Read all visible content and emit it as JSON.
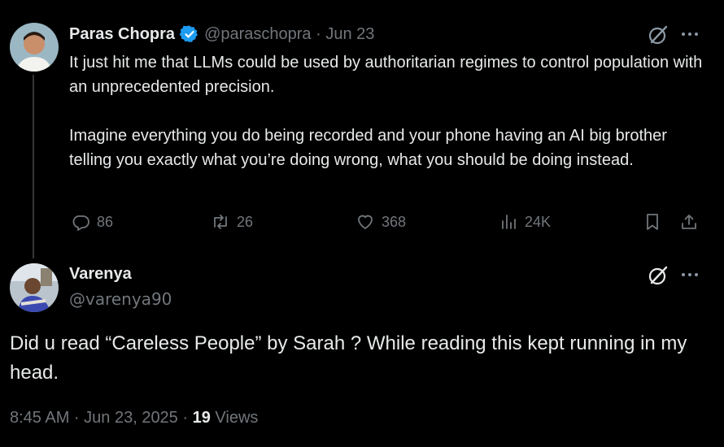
{
  "tweet": {
    "author_name": "Paras Chopra",
    "author_handle": "@paraschopra",
    "separator": " · ",
    "date": "Jun 23",
    "text": "It just hit me that LLMs could be used by authoritarian regimes to control population with an unprecedented precision.\n\nImagine everything you do being recorded and your phone having an AI big brother telling you exactly what you’re doing wrong, what you should be doing instead.",
    "stats": {
      "replies": "86",
      "reposts": "26",
      "likes": "368",
      "views": "24K"
    }
  },
  "reply": {
    "author_name": "Varenya",
    "author_handle": "@varenya90",
    "text": "Did u read “Careless People” by Sarah ? While reading this kept running in my head.",
    "timestamp": "8:45 AM · Jun 23, 2025 · ",
    "views_count": "19",
    "views_label": " Views"
  },
  "colors": {
    "background": "#000000",
    "text": "#e7e9ea",
    "muted": "#71767b",
    "verified": "#1d9bf0"
  },
  "icons": [
    "verified-badge-icon",
    "grok-icon",
    "more-icon",
    "reply-icon",
    "repost-icon",
    "like-icon",
    "views-icon",
    "bookmark-icon",
    "share-icon"
  ]
}
